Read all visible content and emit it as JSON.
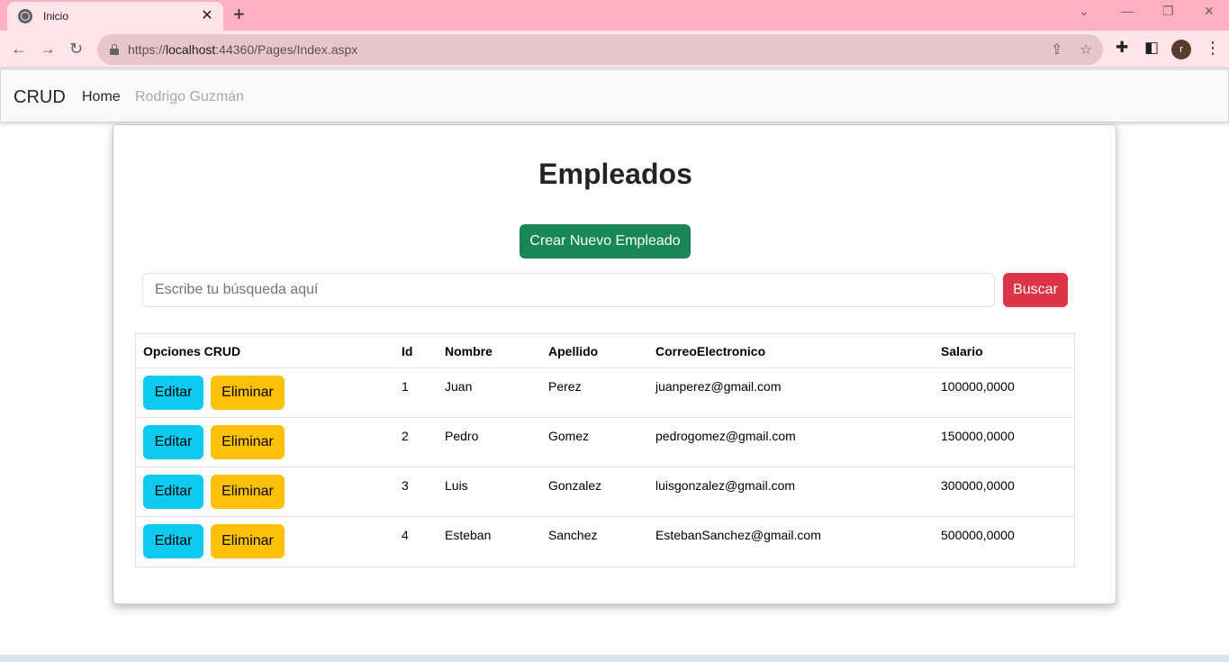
{
  "browser": {
    "tab_title": "Inicio",
    "tab_close": "✕",
    "new_tab": "+",
    "url_prefix": "https://",
    "url_host": "localhost",
    "url_rest": ":44360/Pages/Index.aspx",
    "profile_initial": "r"
  },
  "navbar": {
    "brand": "CRUD",
    "home": "Home",
    "user": "Rodrigo Guzmán"
  },
  "page": {
    "title": "Empleados",
    "create_button": "Crear Nuevo Empleado",
    "search_placeholder": "Escribe tu búsqueda aquí",
    "search_button": "Buscar"
  },
  "table": {
    "headers": [
      "Opciones CRUD",
      "Id",
      "Nombre",
      "Apellido",
      "CorreoElectronico",
      "Salario"
    ],
    "edit_label": "Editar",
    "delete_label": "Eliminar",
    "rows": [
      {
        "id": "1",
        "nombre": "Juan",
        "apellido": "Perez",
        "correo": "juanperez@gmail.com",
        "salario": "100000,0000"
      },
      {
        "id": "2",
        "nombre": "Pedro",
        "apellido": "Gomez",
        "correo": "pedrogomez@gmail.com",
        "salario": "150000,0000"
      },
      {
        "id": "3",
        "nombre": "Luis",
        "apellido": "Gonzalez",
        "correo": "luisgonzalez@gmail.com",
        "salario": "300000,0000"
      },
      {
        "id": "4",
        "nombre": "Esteban",
        "apellido": "Sanchez",
        "correo": "EstebanSanchez@gmail.com",
        "salario": "500000,0000"
      }
    ]
  },
  "colors": {
    "create": "#198754",
    "search": "#dc3545",
    "edit": "#0dcaf0",
    "delete": "#ffc107",
    "chrome": "#feb0c0"
  }
}
